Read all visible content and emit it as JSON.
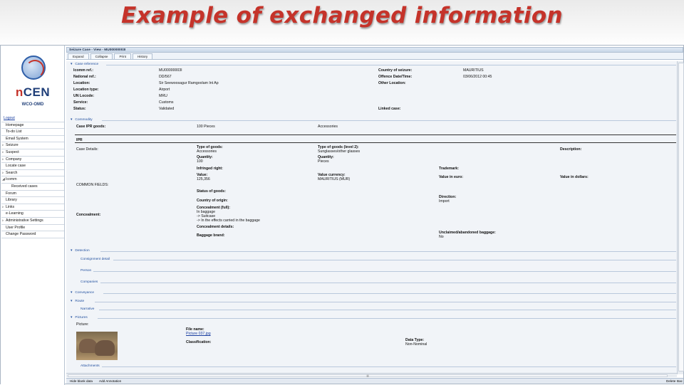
{
  "slide": {
    "title": "Example of exchanged information"
  },
  "logo": {
    "brand_n": "n",
    "brand_cen": "CEN",
    "sub": "WCO-OMD"
  },
  "nav": [
    {
      "label": "Logout",
      "arrow": ""
    },
    {
      "label": "Homepage",
      "arrow": ""
    },
    {
      "label": "To-do List",
      "arrow": ""
    },
    {
      "label": "Email System",
      "arrow": ""
    },
    {
      "label": "Seizure",
      "arrow": "▹"
    },
    {
      "label": "Suspect",
      "arrow": "▹"
    },
    {
      "label": "Company",
      "arrow": "▹"
    },
    {
      "label": "Locate case",
      "arrow": ""
    },
    {
      "label": "Search",
      "arrow": "▹"
    },
    {
      "label": "Icomm",
      "arrow": "◢"
    },
    {
      "label": "Received cases",
      "arrow": ""
    },
    {
      "label": "Forum",
      "arrow": ""
    },
    {
      "label": "Library",
      "arrow": ""
    },
    {
      "label": "Links",
      "arrow": "▹"
    },
    {
      "label": "e-Learning",
      "arrow": ""
    },
    {
      "label": "Administrative Settings",
      "arrow": "▹"
    },
    {
      "label": "User Profile",
      "arrow": ""
    },
    {
      "label": "Change Password",
      "arrow": ""
    }
  ],
  "window": {
    "title": "Seizure Case - View - MU00000003I"
  },
  "tabs": [
    "Expand",
    "Collapse",
    "Print",
    "History"
  ],
  "case_reference": {
    "header": "Case reference",
    "left": [
      {
        "label": "Icomm ref.:",
        "value": "MU00000003I"
      },
      {
        "label": "National ref.:",
        "value": "DD/567"
      },
      {
        "label": "Location:",
        "value": "Sir Seewoosagur Ramgoolam Int Ap"
      },
      {
        "label": "Location type:",
        "value": "Airport"
      },
      {
        "label": "UN Locode:",
        "value": "MRU"
      },
      {
        "label": "Service:",
        "value": "Customs"
      },
      {
        "label": "Status:",
        "value": "Validated"
      }
    ],
    "right": [
      {
        "label": "Country of seizure:",
        "value": "MAURITIUS"
      },
      {
        "label": "Offence Date/Time:",
        "value": "03/06/2012 00:45"
      },
      {
        "label": "Other Location:",
        "value": ""
      },
      {
        "label": "Linked case:",
        "value": ""
      }
    ]
  },
  "commodity": {
    "header": "Commodity",
    "ipr_goods_label": "Case IPR goods:",
    "ipr_goods_qty": "100 Pieces",
    "ipr_goods_type": "Accessories",
    "ipr_title": "IPR",
    "case_details": "Case Details:",
    "type_goods_label": "Type of goods:",
    "type_goods_value": "Accessories",
    "type_goods2_label": "Type of goods (level 2):",
    "type_goods2_value": "Sunglasses/other glasses",
    "description_label": "Description:",
    "quantity_label": "Quantity:",
    "quantity_value": "100",
    "quantity2_label": "Quantity:",
    "quantity2_value": "Pieces",
    "infringed_label": "Infringed right:",
    "trademark_label": "Trademark:",
    "value_label": "Value:",
    "value_value": "125,356",
    "currency_label": "Value currency:",
    "currency_value": "MAURITIUS (MUR)",
    "euro_label": "Value in euro:",
    "dollars_label": "Value in dollars:",
    "common_fields": "COMMON FIELDS:",
    "status_goods_label": "Status of goods:",
    "country_origin_label": "Country of origin:",
    "direction_label": "Direction:",
    "direction_value": "Import",
    "concealment_label": "Concealment:",
    "concealment_full_label": "Concealment (full):",
    "concealment_full_lines": [
      "In baggage",
      "-> Suitcase",
      "-> In the effects carried in the baggage"
    ],
    "concealment_details_label": "Concealment details:",
    "baggage_brand_label": "Baggage brand:",
    "unclaimed_label": "Unclaimed/abandoned baggage:",
    "unclaimed_value": "No"
  },
  "sections": {
    "detection": "Detection",
    "consignment": "Consignment detail",
    "person": "Person",
    "companies": "Companies",
    "conveyance": "Conveyance",
    "route": "Route",
    "narrative": "Narrative",
    "pictures": "Pictures",
    "attachments": "Attachments"
  },
  "pictures": {
    "picture_label": "Picture:",
    "file_name_label": "File name:",
    "file_name_value": "Picture 037.jpg",
    "classification_label": "Classification:",
    "data_type_label": "Data Type:",
    "data_type_value": "Non-Nominal"
  },
  "footer": {
    "hide_blank": "Hide blank data",
    "add_annotation": "Add Annotation",
    "delete": "Delete",
    "back": "Bac"
  },
  "scroll": {
    "grip": "|||"
  }
}
